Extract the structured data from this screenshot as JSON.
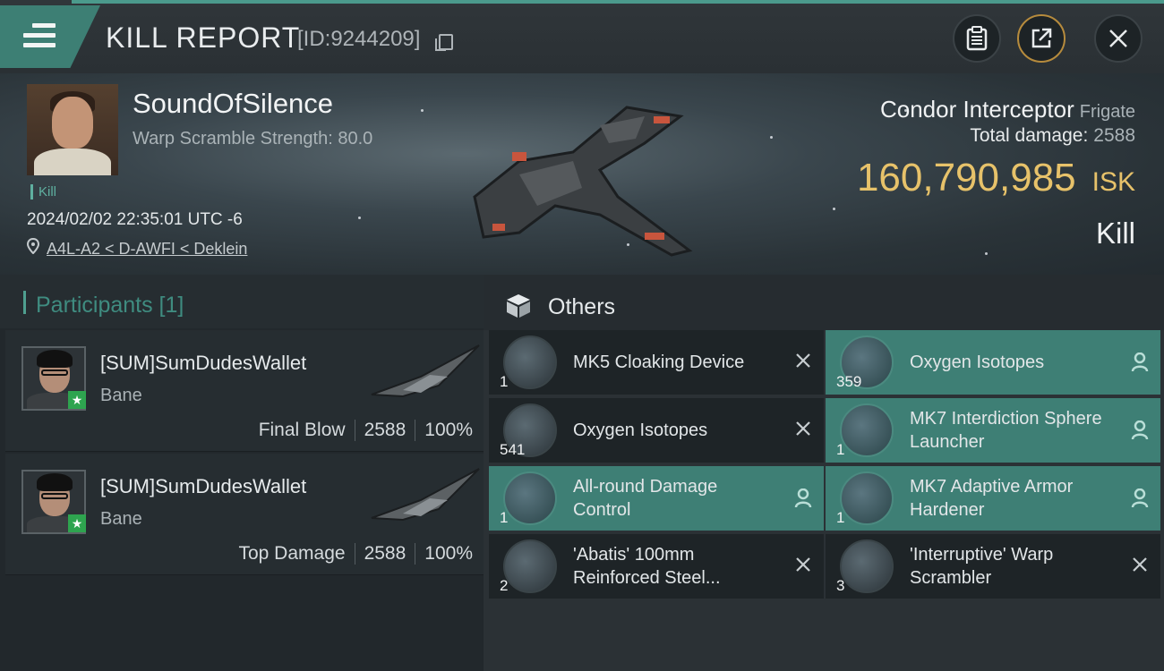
{
  "header": {
    "title": "KILL REPORT",
    "report_id": "[ID:9244209]"
  },
  "victim": {
    "name": "SoundOfSilence",
    "warp_scramble": "Warp Scramble Strength: 80.0",
    "tag": "Kill",
    "datetime": "2024/02/02 22:35:01 UTC -6",
    "location": "A4L-A2 < D-AWFI < Deklein",
    "ship_name": "Condor Interceptor",
    "ship_class": "Frigate",
    "total_damage_label": "Total damage:",
    "total_damage": "2588",
    "isk_value": "160,790,985",
    "isk_unit": "ISK",
    "result": "Kill"
  },
  "participants": {
    "title": "Participants [1]",
    "rows": [
      {
        "name": "[SUM]SumDudesWallet",
        "ship": "Bane",
        "role": "Final Blow",
        "damage": "2588",
        "percent": "100%"
      },
      {
        "name": "[SUM]SumDudesWallet",
        "ship": "Bane",
        "role": "Top Damage",
        "damage": "2588",
        "percent": "100%"
      }
    ]
  },
  "others": {
    "title": "Others",
    "items": [
      {
        "name": "MK5 Cloaking Device",
        "qty": "1",
        "state": "destroyed"
      },
      {
        "name": "Oxygen Isotopes",
        "qty": "359",
        "state": "dropped"
      },
      {
        "name": "Oxygen Isotopes",
        "qty": "541",
        "state": "destroyed"
      },
      {
        "name": "MK7 Interdiction Sphere Launcher",
        "qty": "1",
        "state": "dropped"
      },
      {
        "name": "All-round Damage Control",
        "qty": "1",
        "state": "dropped"
      },
      {
        "name": "MK7 Adaptive Armor Hardener",
        "qty": "1",
        "state": "dropped"
      },
      {
        "name": "'Abatis' 100mm Reinforced Steel...",
        "qty": "2",
        "state": "destroyed"
      },
      {
        "name": "'Interruptive' Warp Scrambler",
        "qty": "3",
        "state": "destroyed"
      }
    ]
  },
  "colors": {
    "accent_teal": "#3e7f75",
    "isk_gold": "#e7c26a",
    "header_bg": "#2a3034"
  },
  "icons": {
    "menu": "hamburger-icon",
    "copy": "copy-icon",
    "clipboard": "clipboard-icon",
    "share": "share-icon",
    "close": "close-icon",
    "location": "location-pin-icon",
    "others": "box-icon",
    "destroyed": "x-mark-icon",
    "dropped": "person-icon"
  }
}
